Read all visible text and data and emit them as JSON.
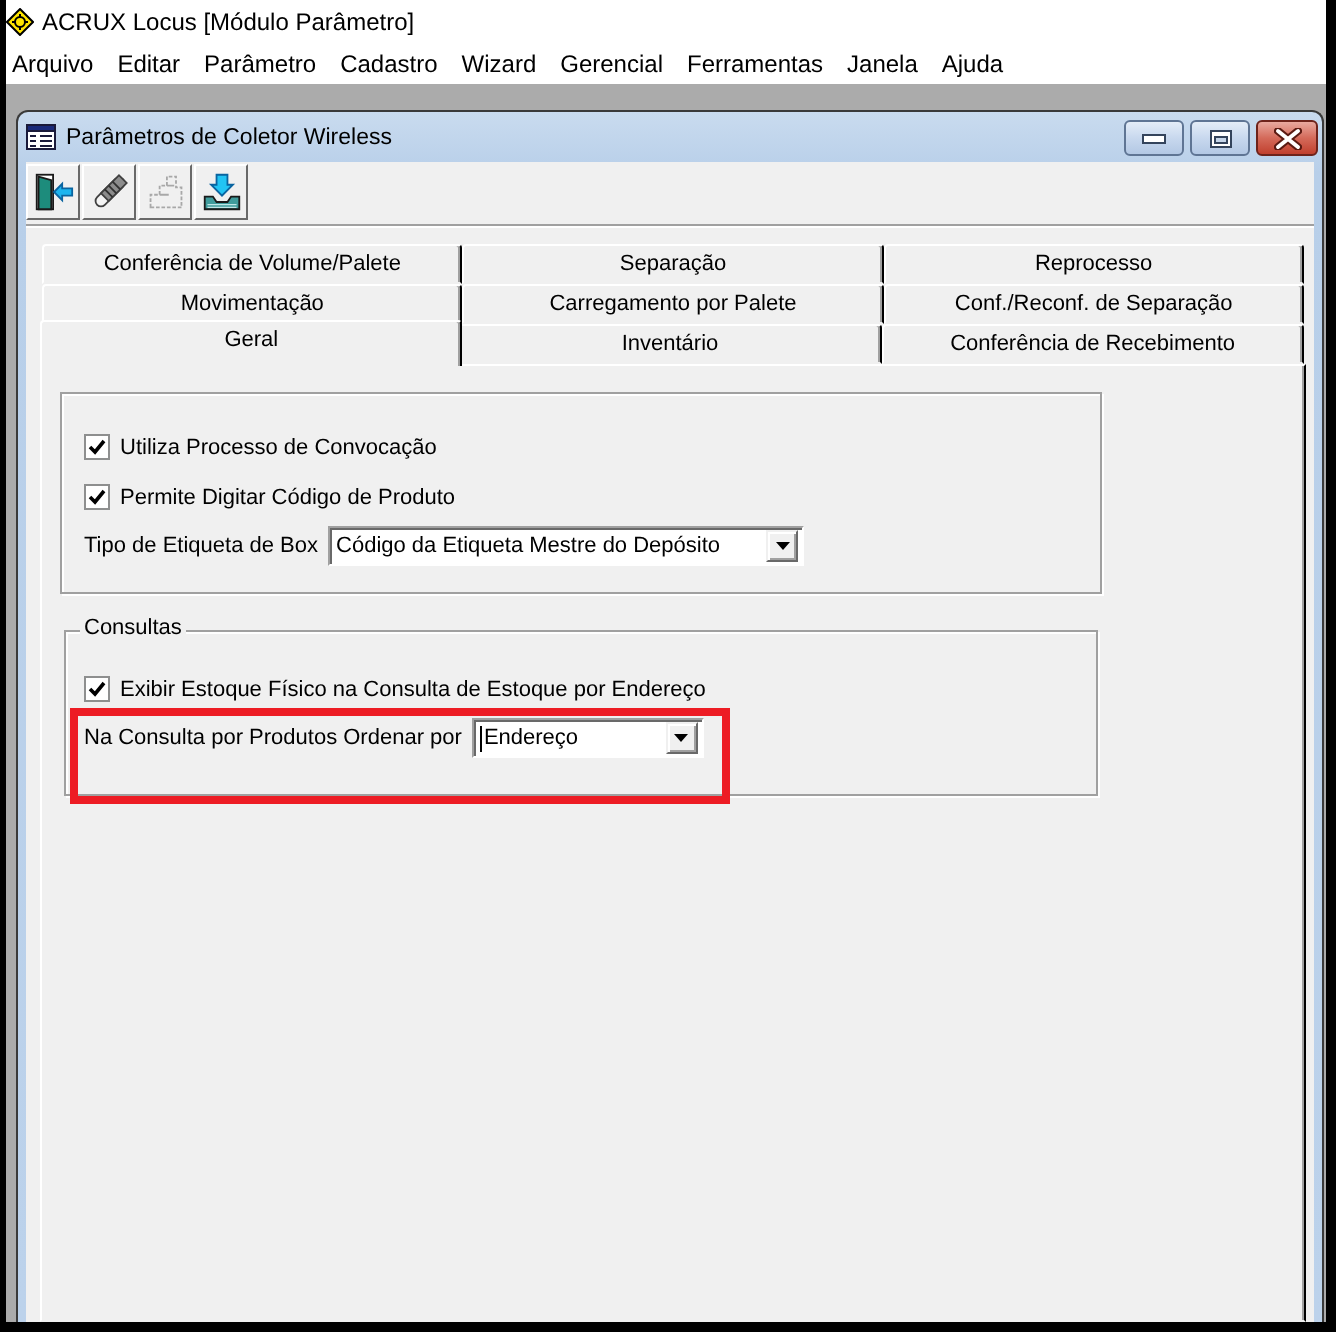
{
  "app": {
    "title": "ACRUX Locus [Módulo Parâmetro]"
  },
  "menu": [
    "Arquivo",
    "Editar",
    "Parâmetro",
    "Cadastro",
    "Wizard",
    "Gerencial",
    "Ferramentas",
    "Janela",
    "Ajuda"
  ],
  "window": {
    "title": "Parâmetros de Coletor Wireless",
    "controls": [
      {
        "kind": "minimize"
      },
      {
        "kind": "maximize"
      },
      {
        "kind": "close"
      }
    ]
  },
  "toolbar": [
    {
      "kind": "exit",
      "disabled": false
    },
    {
      "kind": "pencil",
      "disabled": false
    },
    {
      "kind": "blocks",
      "disabled": true
    },
    {
      "kind": "import",
      "disabled": false
    }
  ],
  "tab_rows": [
    {
      "tabs": [
        {
          "label": "Conferência de Volume/Palete",
          "selected": false
        },
        {
          "label": "Separação",
          "selected": false
        },
        {
          "label": "Reprocesso",
          "selected": false
        }
      ]
    },
    {
      "tabs": [
        {
          "label": "Movimentação",
          "selected": false
        },
        {
          "label": "Carregamento por Palete",
          "selected": false
        },
        {
          "label": "Conf./Reconf. de Separação",
          "selected": false
        }
      ]
    },
    {
      "tabs": [
        {
          "label": "Geral",
          "selected": true
        },
        {
          "label": "Inventário",
          "selected": false
        },
        {
          "label": "Conferência de Recebimento",
          "selected": false
        }
      ]
    }
  ],
  "groups": [
    {
      "items": [
        {
          "kind": "checkbox",
          "label": "Utiliza Processo de Convocação",
          "checked": true,
          "highlighted": false
        },
        {
          "kind": "checkbox",
          "label": "Permite Digitar Código de Produto",
          "checked": true,
          "highlighted": false
        },
        {
          "kind": "select",
          "label": "Tipo de Etiqueta de Box",
          "value": "Código da Etiqueta Mestre do Depósito",
          "focused": false,
          "highlighted": false
        }
      ]
    },
    {
      "legend": "Consultas",
      "items": [
        {
          "kind": "checkbox",
          "label": "Exibir Estoque Físico na Consulta de Estoque por Endereço",
          "checked": true,
          "highlighted": false
        },
        {
          "kind": "select",
          "label": "Na Consulta por Produtos Ordenar por",
          "value": "Endereço",
          "focused": true,
          "highlighted": true
        }
      ]
    }
  ]
}
